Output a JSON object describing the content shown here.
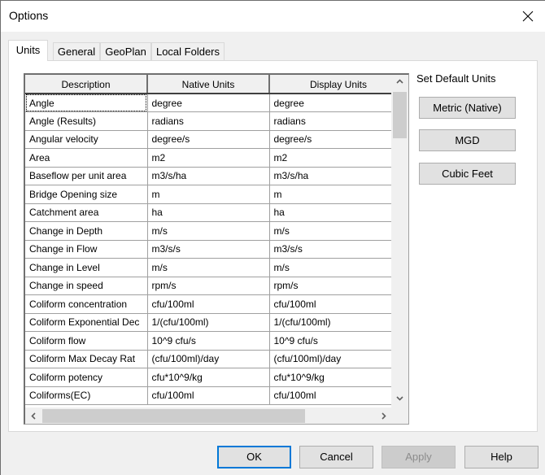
{
  "window": {
    "title": "Options",
    "close_icon": "close-icon"
  },
  "tabs": [
    {
      "label": "Units",
      "active": true
    },
    {
      "label": "General",
      "active": false
    },
    {
      "label": "GeoPlan",
      "active": false
    },
    {
      "label": "Local Folders",
      "active": false
    }
  ],
  "units_table": {
    "columns": [
      "Description",
      "Native Units",
      "Display Units"
    ],
    "rows": [
      {
        "description": "Angle",
        "native": "degree",
        "display": "degree"
      },
      {
        "description": "Angle (Results)",
        "native": "radians",
        "display": "radians"
      },
      {
        "description": "Angular velocity",
        "native": "degree/s",
        "display": "degree/s"
      },
      {
        "description": "Area",
        "native": "m2",
        "display": "m2"
      },
      {
        "description": "Baseflow per unit area",
        "native": "m3/s/ha",
        "display": "m3/s/ha"
      },
      {
        "description": "Bridge Opening size",
        "native": "m",
        "display": "m"
      },
      {
        "description": "Catchment area",
        "native": "ha",
        "display": "ha"
      },
      {
        "description": "Change in Depth",
        "native": "m/s",
        "display": "m/s"
      },
      {
        "description": "Change in Flow",
        "native": "m3/s/s",
        "display": "m3/s/s"
      },
      {
        "description": "Change in Level",
        "native": "m/s",
        "display": "m/s"
      },
      {
        "description": "Change in speed",
        "native": "rpm/s",
        "display": "rpm/s"
      },
      {
        "description": "Coliform concentration",
        "native": "cfu/100ml",
        "display": "cfu/100ml"
      },
      {
        "description": "Coliform Exponential Dec",
        "native": "1/(cfu/100ml)",
        "display": "1/(cfu/100ml)"
      },
      {
        "description": "Coliform flow",
        "native": "10^9 cfu/s",
        "display": "10^9 cfu/s"
      },
      {
        "description": "Coliform Max Decay Rat",
        "native": "(cfu/100ml)/day",
        "display": "(cfu/100ml)/day"
      },
      {
        "description": "Coliform potency",
        "native": "cfu*10^9/kg",
        "display": "cfu*10^9/kg"
      },
      {
        "description": "Coliforms(EC)",
        "native": "cfu/100ml",
        "display": "cfu/100ml"
      }
    ]
  },
  "set_default_units": {
    "label": "Set Default Units",
    "buttons": [
      "Metric (Native)",
      "MGD",
      "Cubic Feet"
    ]
  },
  "footer": {
    "ok": "OK",
    "cancel": "Cancel",
    "apply": "Apply",
    "help": "Help"
  },
  "colors": {
    "default_button_border": "#0078d7",
    "panel_bg": "#ffffff",
    "dialog_bg": "#f0f0f0"
  }
}
